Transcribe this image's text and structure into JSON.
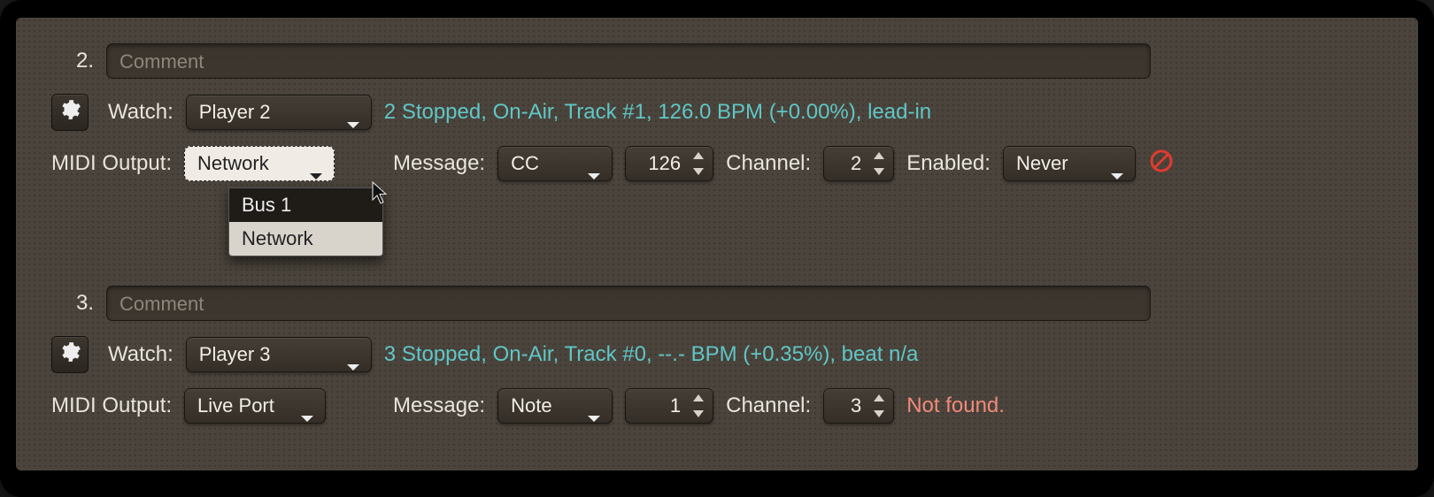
{
  "sections": [
    {
      "index": "2.",
      "comment_placeholder": "Comment",
      "watch_label": "Watch:",
      "watch_value": "Player 2",
      "status": "2 Stopped, On-Air, Track #1, 126.0 BPM (+0.00%), lead-in",
      "midi_output_label": "MIDI Output:",
      "midi_output_value": "Network",
      "midi_output_options": [
        "Bus 1",
        "Network"
      ],
      "message_label": "Message:",
      "message_value": "CC",
      "message_number": "126",
      "channel_label": "Channel:",
      "channel_value": "2",
      "enabled_label": "Enabled:",
      "enabled_value": "Never",
      "error": null,
      "show_forbidden": true
    },
    {
      "index": "3.",
      "comment_placeholder": "Comment",
      "watch_label": "Watch:",
      "watch_value": "Player 3",
      "status": "3 Stopped, On-Air, Track #0, --.- BPM (+0.35%), beat n/a",
      "midi_output_label": "MIDI Output:",
      "midi_output_value": "Live Port",
      "message_label": "Message:",
      "message_value": "Note",
      "message_number": "1",
      "channel_label": "Channel:",
      "channel_value": "3",
      "enabled_label": null,
      "enabled_value": null,
      "error": "Not found.",
      "show_forbidden": false
    }
  ]
}
